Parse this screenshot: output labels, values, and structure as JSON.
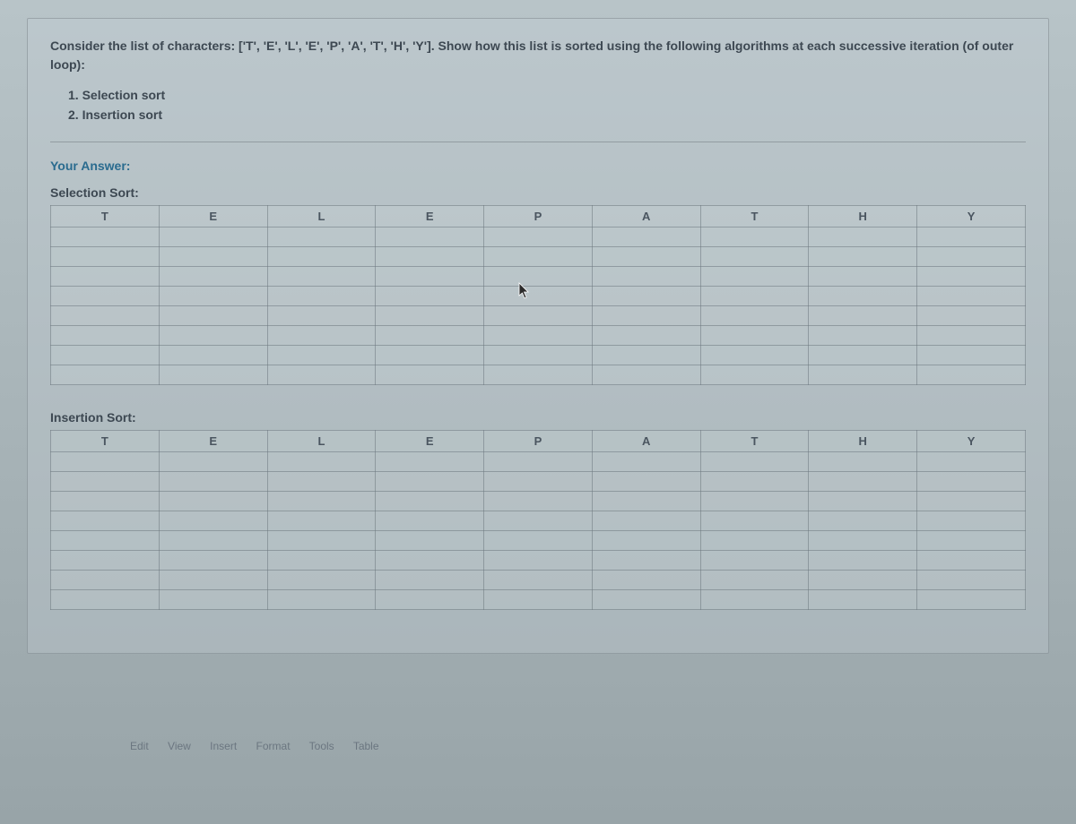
{
  "question": {
    "prompt": "Consider the list of characters: ['T', 'E', 'L', 'E', 'P', 'A', 'T', 'H', 'Y']. Show how this list is sorted using the following algorithms at each successive iteration (of outer loop):",
    "items": [
      "1. Selection sort",
      "2. Insertion sort"
    ]
  },
  "answer_label": "Your Answer:",
  "sections": [
    {
      "label": "Selection Sort:",
      "header": [
        "T",
        "E",
        "L",
        "E",
        "P",
        "A",
        "T",
        "H",
        "Y"
      ],
      "blank_rows": 8
    },
    {
      "label": "Insertion Sort:",
      "header": [
        "T",
        "E",
        "L",
        "E",
        "P",
        "A",
        "T",
        "H",
        "Y"
      ],
      "blank_rows": 8
    }
  ],
  "toolbar": [
    "Edit",
    "View",
    "Insert",
    "Format",
    "Tools",
    "Table"
  ]
}
